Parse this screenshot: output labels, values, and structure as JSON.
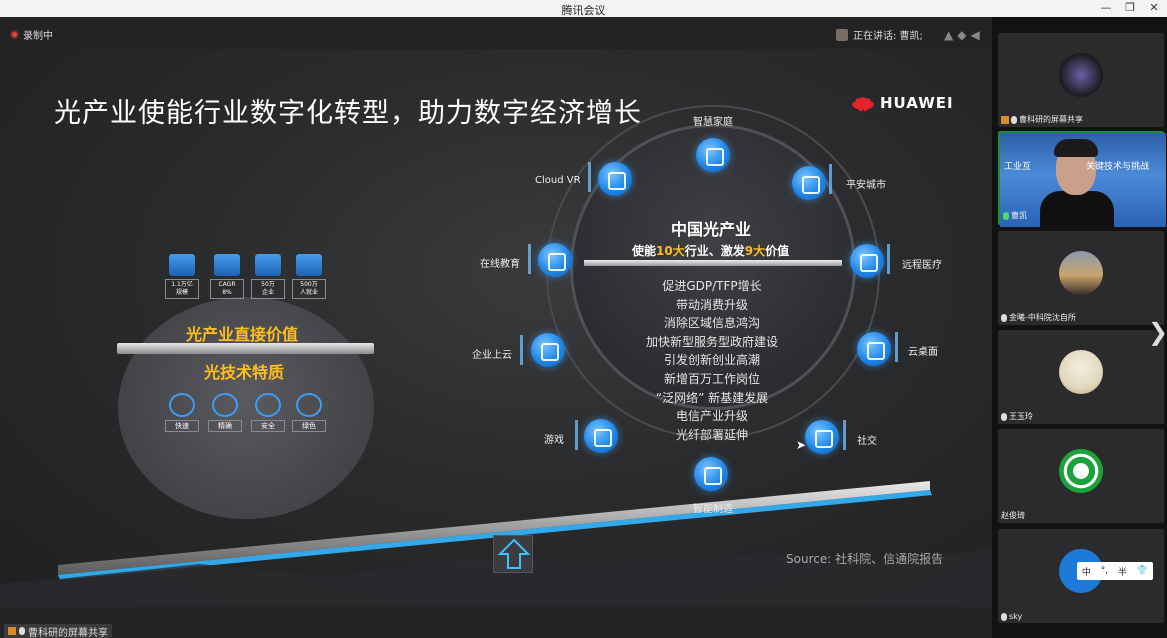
{
  "window": {
    "title": "腾讯会议",
    "controls": [
      "—",
      "❐",
      "✕"
    ]
  },
  "meeting": {
    "recording": "录制中",
    "speaking": "正在讲话: 曹凯;",
    "share_label": "曹科研的屏幕共享"
  },
  "slide": {
    "title": "光产业使能行业数字化转型，助力数字经济增长",
    "brand": "HUAWEI",
    "stats": [
      "1.1万亿\n规模",
      "CAGR\n8%",
      "50万\n企业",
      "500万\n人就业"
    ],
    "direct_value": "光产业直接价值",
    "tech_quality": "光技术特质",
    "features": [
      "快速",
      "精确",
      "安全",
      "绿色"
    ],
    "center_title": "中国光产业",
    "center_sub_pre": "使能",
    "center_sub_n1": "10大",
    "center_sub_mid": "行业、激发",
    "center_sub_n2": "9大",
    "center_sub_post": "价值",
    "values": [
      "促进GDP/TFP增长",
      "带动消费升级",
      "消除区域信息鸿沟",
      "加快新型服务型政府建设",
      "引发创新创业高潮",
      "新增百万工作岗位",
      "“泛网络” 新基建发展",
      "电信产业升级",
      "光纤部署延伸"
    ],
    "nodes": {
      "home": "智慧家庭",
      "city": "平安城市",
      "medical": "远程医疗",
      "desktop": "云桌面",
      "social": "社交",
      "manufacturing": "智能制造",
      "game": "游戏",
      "enterprise": "企业上云",
      "education": "在线教育",
      "vr": "Cloud VR"
    },
    "source": "Source: 社科院、信通院报告"
  },
  "participants": [
    {
      "name": "曹科研的屏幕共享",
      "type": "avatar"
    },
    {
      "name": "曹凯",
      "type": "video",
      "text_left": "工业互",
      "text_right": "关键技术与挑战"
    },
    {
      "name": "金曦-中科院沈自所",
      "type": "avatar"
    },
    {
      "name": "王玉玲",
      "type": "avatar"
    },
    {
      "name": "赵俊琦",
      "type": "avatar"
    },
    {
      "name": "sky",
      "type": "avatar"
    }
  ],
  "ime": [
    "中",
    "°,",
    "半",
    "👕"
  ],
  "colors": {
    "accent": "#ffbe1e",
    "blue": "#1f86e8",
    "huawei_red": "#e3222b"
  }
}
